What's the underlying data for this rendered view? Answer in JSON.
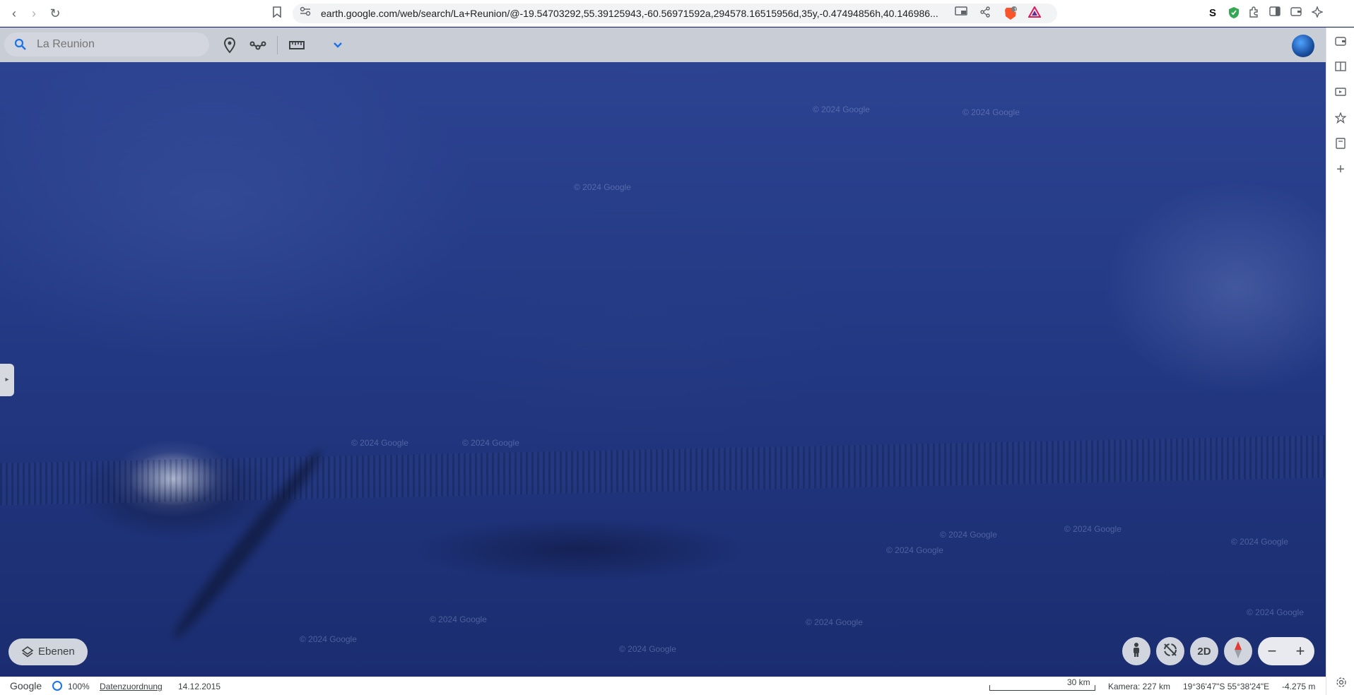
{
  "browser": {
    "url": "earth.google.com/web/search/La+Reunion/@-19.54703292,55.39125943,-60.56971592a,294578.16515956d,35y,-0.47494856h,40.146986...",
    "back_glyph": "‹",
    "forward_glyph": "›",
    "reload_glyph": "↻",
    "brave_badge": "1",
    "ext_s_label": "S"
  },
  "search": {
    "placeholder": "La Reunion",
    "value": "La Reunion"
  },
  "toolbar": {
    "icons": [
      "search-icon",
      "placemark-icon",
      "path-icon",
      "ruler-icon",
      "chevron-down-icon"
    ]
  },
  "map": {
    "layers_label": "Ebenen",
    "mode_2d_label": "2D",
    "zoom_out_glyph": "−",
    "zoom_in_glyph": "+",
    "handle_glyph": "▸",
    "watermark": "© 2024 Google"
  },
  "status": {
    "brand": "Google",
    "load_percent": "100%",
    "attribution_label": "Datenzuordnung",
    "date": "14.12.2015",
    "scale_label": "30 km",
    "camera": "Kamera: 227 km",
    "coordinates": "19°36'47\"S 55°38'24\"E",
    "elevation": "-4.275 m"
  },
  "colors": {
    "accent": "#1a73e8",
    "ocean": "#243a86",
    "toolbar": "#c9cdd6"
  }
}
